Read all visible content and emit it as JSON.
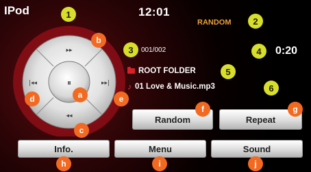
{
  "status": {
    "source": "IPod",
    "time": "12:01",
    "mode": "RANDOM"
  },
  "track": {
    "count": "001/002",
    "elapsed": "0:20",
    "folder": "ROOT FOLDER",
    "title": "01 Love & Music.mp3"
  },
  "controls": {
    "play_pause_glyph": "⏸",
    "next_glyph": "▸▸",
    "prev_glyph": "◂◂",
    "skip_next_glyph": "▸▸|",
    "skip_prev_glyph": "|◂◂"
  },
  "buttons": {
    "random": "Random",
    "repeat": "Repeat",
    "info": "Info.",
    "menu": "Menu",
    "sound": "Sound"
  },
  "badges": {
    "n1": "1",
    "n2": "2",
    "n3": "3",
    "n4": "4",
    "n5": "5",
    "n6": "6",
    "a": "a",
    "b": "b",
    "c": "c",
    "d": "d",
    "e": "e",
    "f": "f",
    "g": "g",
    "h": "h",
    "i": "i",
    "j": "j"
  },
  "colors": {
    "accent": "#e8a03a",
    "badge_number": "#d7de2c",
    "badge_letter": "#f26a21",
    "icon_red": "#d8202a"
  }
}
